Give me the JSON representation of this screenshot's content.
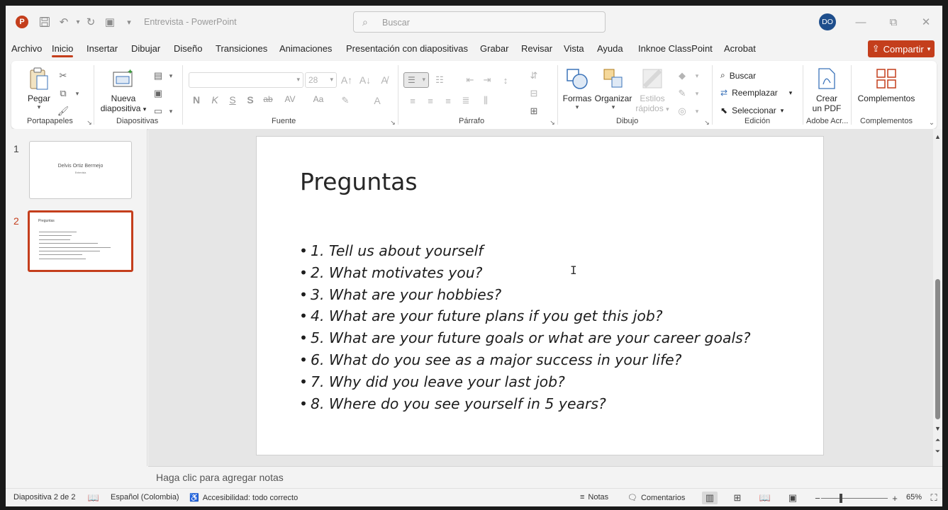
{
  "window": {
    "doc_name": "Entrevista",
    "title_sep": "-",
    "app_name": "PowerPoint",
    "search_placeholder": "Buscar",
    "avatar_initials": "DO",
    "minimize_icon": "—",
    "restore_icon": "⧉",
    "close_icon": "✕"
  },
  "quick_access": {
    "save_icon": "💾",
    "undo_icon": "↶",
    "redo_icon": "↻",
    "present_icon": "▣",
    "customize_icon": "▾"
  },
  "menu_tabs": [
    {
      "label": "Archivo"
    },
    {
      "label": "Inicio"
    },
    {
      "label": "Insertar"
    },
    {
      "label": "Dibujar"
    },
    {
      "label": "Diseño"
    },
    {
      "label": "Transiciones"
    },
    {
      "label": "Animaciones"
    },
    {
      "label": "Presentación con diapositivas"
    },
    {
      "label": "Grabar"
    },
    {
      "label": "Revisar"
    },
    {
      "label": "Vista"
    },
    {
      "label": "Ayuda"
    },
    {
      "label": "Inknoe ClassPoint"
    },
    {
      "label": "Acrobat"
    }
  ],
  "share_label": "Compartir",
  "ribbon": {
    "clipboard": {
      "paste_label": "Pegar",
      "group_label": "Portapapeles"
    },
    "slides": {
      "new_slide_line1": "Nueva",
      "new_slide_line2": "diapositiva",
      "group_label": "Diapositivas"
    },
    "font": {
      "size_value": "28",
      "group_label": "Fuente",
      "bold": "N",
      "italic": "K",
      "underline": "S",
      "shadow": "S",
      "strike": "ab",
      "spacing": "AV",
      "case": "Aa"
    },
    "paragraph": {
      "group_label": "Párrafo"
    },
    "drawing": {
      "shapes_label": "Formas",
      "arrange_label": "Organizar",
      "styles_line1": "Estilos",
      "styles_line2": "rápidos",
      "group_label": "Dibujo"
    },
    "editing": {
      "find_label": "Buscar",
      "replace_label": "Reemplazar",
      "select_label": "Seleccionar",
      "group_label": "Edición"
    },
    "adobe": {
      "create_line1": "Crear",
      "create_line2": "un PDF",
      "group_label": "Adobe Acr..."
    },
    "addins": {
      "label": "Complementos",
      "group_label": "Complementos"
    }
  },
  "thumbnails": [
    {
      "number": "1",
      "title": "Delvis Ortiz Bermejo",
      "subtitle": "Entrevista"
    },
    {
      "number": "2",
      "title": "Preguntas"
    }
  ],
  "slide": {
    "title": "Preguntas",
    "bullet_char": "•",
    "bullets": [
      "1. Tell us about yourself",
      "2. What motivates you?",
      "3. What are your hobbies?",
      "4. What are your future plans if you get this job?",
      "5. What are your future goals or what are your career goals?",
      "6. What do you see as a major success in your life?",
      "7. Why did you leave your last job?",
      "8. Where do you see yourself in 5 years?"
    ]
  },
  "notes_placeholder": "Haga clic para agregar notas",
  "status": {
    "slide_counter": "Diapositiva 2 de 2",
    "language": "Español (Colombia)",
    "accessibility": "Accesibilidad: todo correcto",
    "notes_label": "Notas",
    "comments_label": "Comentarios",
    "zoom": "65%"
  },
  "colors": {
    "accent": "#c43e1c",
    "avatar": "#1e4e8c"
  }
}
